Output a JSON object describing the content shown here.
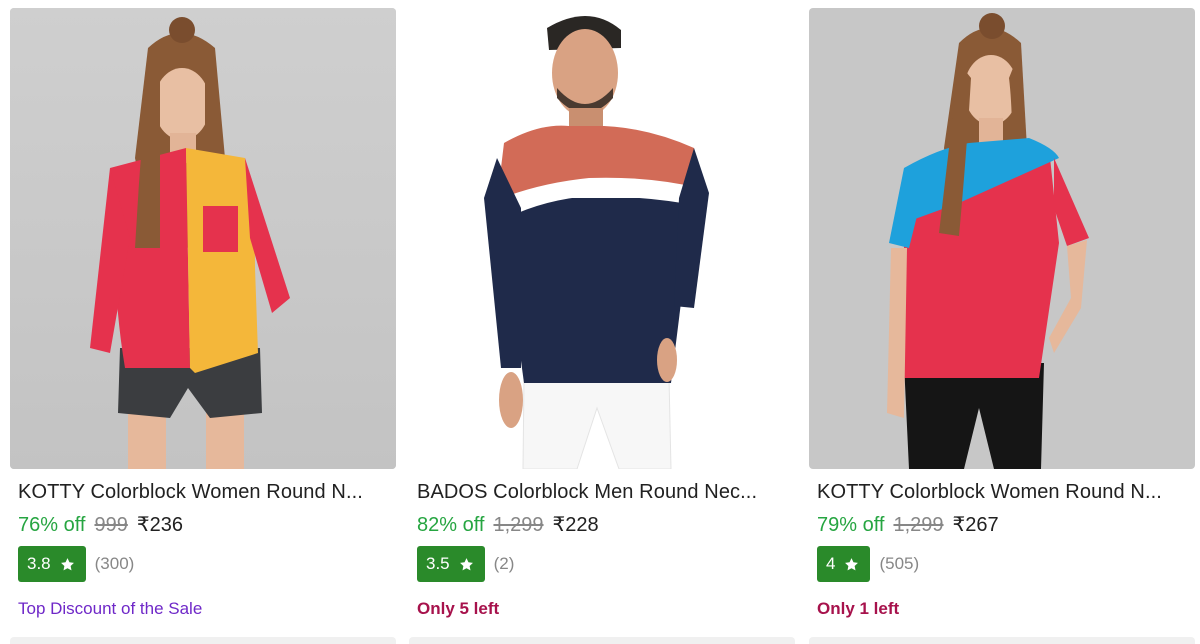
{
  "products": [
    {
      "title": "KOTTY Colorblock Women Round N...",
      "discount": "76% off",
      "mrp": "999",
      "price": "₹236",
      "rating": "3.8",
      "rating_count": "(300)",
      "tag": "Top Discount of the Sale",
      "tag_color": "#6f28c8",
      "image_icon": "women-colorblock-tshirt-image"
    },
    {
      "title": "BADOS Colorblock Men Round Nec...",
      "discount": "82% off",
      "mrp": "1,299",
      "price": "₹228",
      "rating": "3.5",
      "rating_count": "(2)",
      "tag": "Only 5 left",
      "tag_color": "#a7124c",
      "image_icon": "men-colorblock-tshirt-image"
    },
    {
      "title": "KOTTY Colorblock Women Round N...",
      "discount": "79% off",
      "mrp": "1,299",
      "price": "₹267",
      "rating": "4",
      "rating_count": "(505)",
      "tag": "Only 1 left",
      "tag_color": "#a7124c",
      "image_icon": "women-colorblock-tshirt-image"
    }
  ],
  "colors": {
    "discount": "#26a541",
    "rating_badge": "#2a8a2a",
    "muted": "#878787"
  },
  "icons": {
    "rating": "star-icon"
  }
}
